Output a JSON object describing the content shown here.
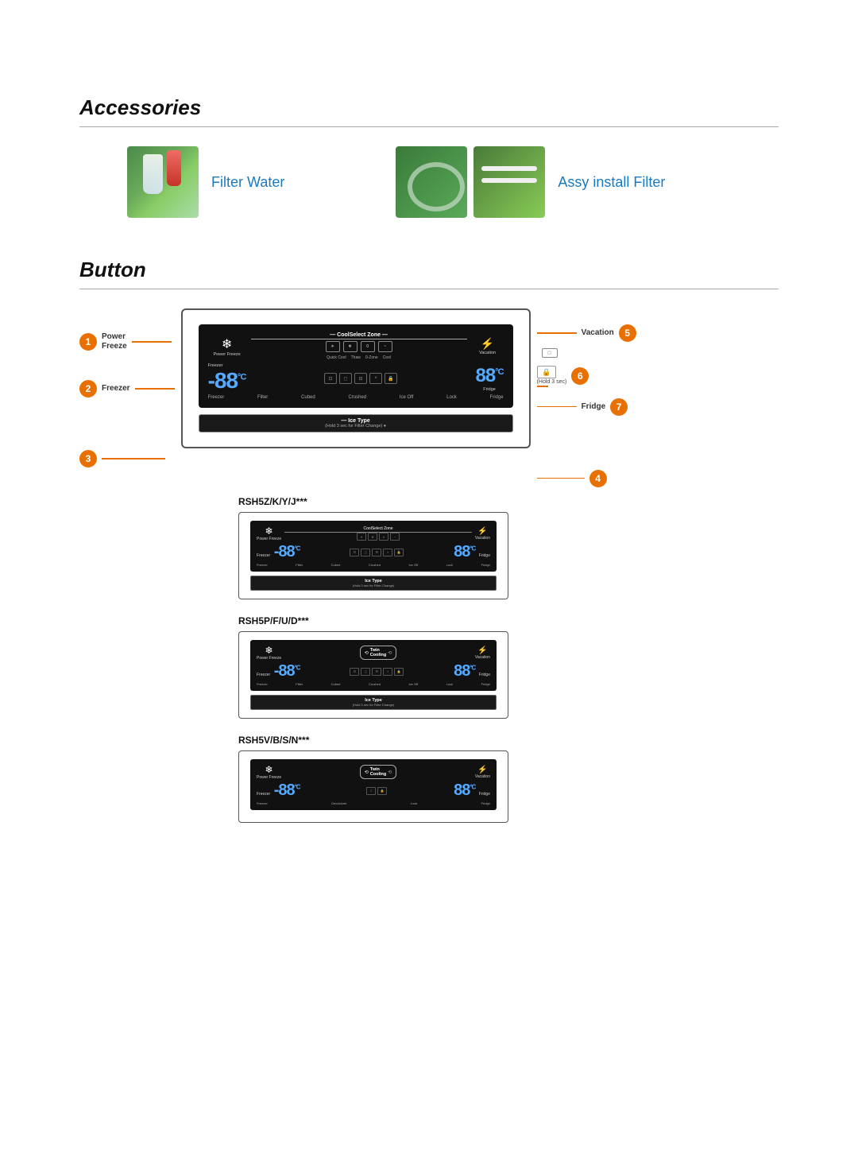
{
  "page": {
    "background": "#ffffff"
  },
  "accessories": {
    "title": "Accessories",
    "items": [
      {
        "id": "filter-water",
        "label": "Filter Water",
        "images": [
          "filter-water-img"
        ]
      },
      {
        "id": "assy-install-filter",
        "label": "Assy install Filter",
        "images": [
          "assy-img-1",
          "assy-img-2"
        ]
      }
    ]
  },
  "button_section": {
    "title": "Button",
    "left_labels": [
      {
        "num": "1",
        "text": "Power\nFreeze"
      },
      {
        "num": "2",
        "text": "Freezer"
      },
      {
        "num": "3",
        "text": ""
      }
    ],
    "right_labels": [
      {
        "num": "5",
        "text": "Vacation"
      },
      {
        "num": "6",
        "text": ""
      },
      {
        "num": "7",
        "text": "Fridge"
      },
      {
        "num": "4",
        "text": ""
      }
    ],
    "panel": {
      "power_freeze_label": "Power\nFreeze",
      "snowflake": "❄",
      "coolselect_zone": "CoolSelect Zone",
      "icons": [
        "Quick Cool",
        "Thaw",
        "0 Zone",
        "Cool"
      ],
      "vacation": "Vacation",
      "vacation_icon": "⚡",
      "freezer_label": "Freezer",
      "temp_display": "-88",
      "temp_unit": "°C",
      "bottom_icons": [
        "Filter",
        "Cubed",
        "Crushed",
        "Ice Off",
        "Lock"
      ],
      "fridge_label": "Fridge",
      "fridge_temp": "88",
      "ice_type_label": "Ice Type",
      "ice_type_sub": "(Hold 3 sec for Filter Change)"
    },
    "right_side_labels": {
      "vacation": "Vacation",
      "hold_label": "(Hold 3 sec)",
      "fridge": "Fridge"
    },
    "models": [
      {
        "id": "rsh5z",
        "title": "RSH5Z/K/Y/J***",
        "has_coolselect": true,
        "has_twin_cooling": false,
        "has_ice_type": true,
        "icons": [
          "Quick Cool",
          "Thaw",
          "0 Zone",
          "Cool"
        ]
      },
      {
        "id": "rsh5p",
        "title": "RSH5P/F/U/D***",
        "has_coolselect": false,
        "has_twin_cooling": true,
        "has_ice_type": true,
        "icons": []
      },
      {
        "id": "rsh5v",
        "title": "RSH5V/B/S/N***",
        "has_coolselect": false,
        "has_twin_cooling": true,
        "has_ice_type": false,
        "icons": []
      }
    ]
  }
}
